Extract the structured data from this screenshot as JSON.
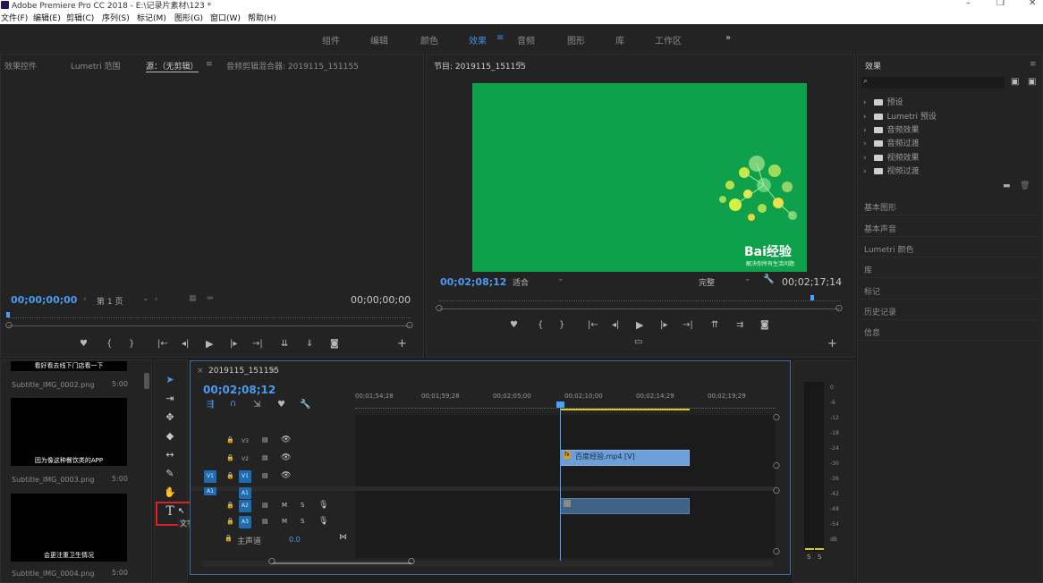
{
  "titlebar": {
    "title": "Adobe Premiere Pro CC 2018 - E:\\记录片素材\\123 *",
    "min": "–",
    "max": "❐",
    "close": "✕"
  },
  "menu": [
    "文件(F)",
    "编辑(E)",
    "剪辑(C)",
    "序列(S)",
    "标记(M)",
    "图形(G)",
    "窗口(W)",
    "帮助(H)"
  ],
  "workspaces": [
    "组件",
    "编辑",
    "颜色",
    "效果",
    "音频",
    "图形",
    "库",
    "工作区",
    "»"
  ],
  "workspace_active": "效果",
  "source_panel": {
    "tabs": [
      "效果控件",
      "Lumetri 范围",
      "源：（无剪辑）",
      "音频剪辑混合器: 2019115_151155"
    ],
    "timecode_left": "00;00;00;00",
    "page": "第 1 页",
    "timecode_right": "00;00;00;00"
  },
  "program_panel": {
    "title": "节目: 2019115_151155",
    "timecode_left": "00;02;08;12",
    "fit": "适合",
    "quality": "完整",
    "timecode_right": "00;02;17;14",
    "watermark_logo": "Bai经验",
    "watermark_sub": "解决你所有生活问题"
  },
  "effects_panel": {
    "title": "效果",
    "search_placeholder": "",
    "tree": [
      "预设",
      "Lumetri 预设",
      "音频效果",
      "音频过渡",
      "视频效果",
      "视频过渡"
    ],
    "sections": [
      "基本图形",
      "基本声音",
      "Lumetri 颜色",
      "库",
      "标记",
      "历史记录",
      "信息"
    ]
  },
  "project": {
    "items": [
      {
        "caption": "看好看去线下门店看一下",
        "name": "",
        "dur": ""
      },
      {
        "caption": "",
        "name": "Subtitle_IMG_0002.png",
        "dur": "5:00"
      },
      {
        "caption": "因为像这种餐饮类的APP",
        "name": "Subtitle_IMG_0003.png",
        "dur": "5:00"
      },
      {
        "caption": "会更注重卫生情况",
        "name": "Subtitle_IMG_0004.png",
        "dur": "5:00"
      }
    ]
  },
  "tools": {
    "tooltip": "文字工具 (T)"
  },
  "timeline": {
    "tab": "2019115_151155",
    "timecode": "00;02;08;12",
    "ruler": [
      "00;01;54;28",
      "00;01;59;28",
      "00;02;05;00",
      "00;02;10;00",
      "00;02;14;29",
      "00;02;19;29"
    ],
    "video_tracks": [
      "V3",
      "V2",
      "V1"
    ],
    "audio_tracks": [
      "A1",
      "A2",
      "A3"
    ],
    "source_v": "V1",
    "source_a": "A1",
    "master_label": "主声道",
    "master_value": "0.0",
    "clip_label": "百度经验.mp4 [V]",
    "m": "M",
    "s": "S"
  },
  "meter": {
    "ticks": [
      "0",
      "-6",
      "-12",
      "-18",
      "-24",
      "-30",
      "-36",
      "-42",
      "-48",
      "-54",
      "dB"
    ],
    "solo_left": "S",
    "solo_right": "S"
  },
  "colors": {
    "accent": "#3d8ee8",
    "program_bg": "#0ea04a",
    "clip_video": "#6c9fd8",
    "clip_audio": "#3f6287",
    "tool_highlight": "#e02020",
    "playhead": "#4aa0ff"
  }
}
